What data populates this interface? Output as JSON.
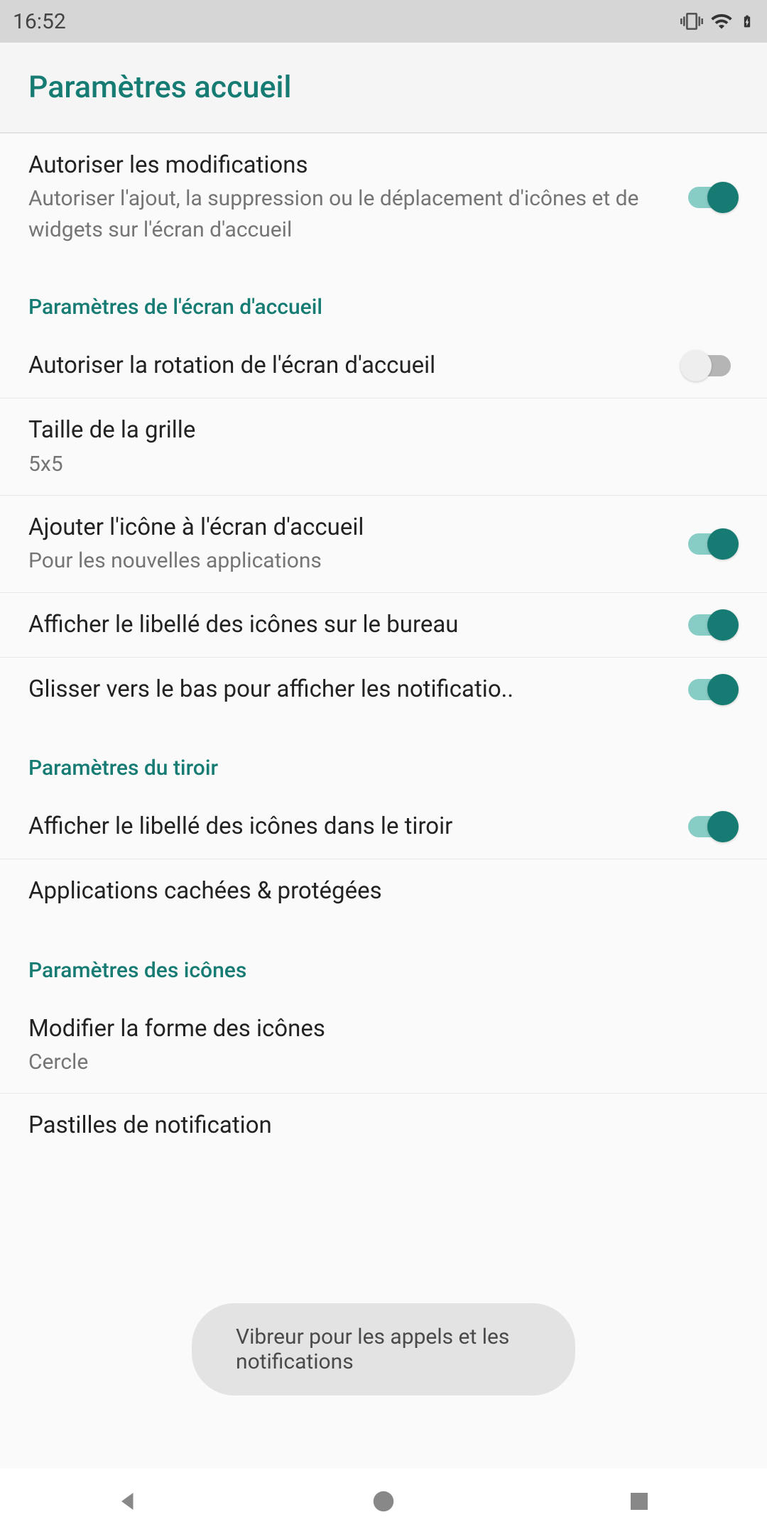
{
  "statusBar": {
    "time": "16:52"
  },
  "header": {
    "title": "Paramètres accueil"
  },
  "settings": {
    "allowEdit": {
      "title": "Autoriser les modifications",
      "subtitle": "Autoriser l'ajout, la suppression ou le déplacement d'icônes et de widgets sur l'écran d'accueil"
    }
  },
  "sectionHome": {
    "header": "Paramètres de l'écran d'accueil",
    "rotation": {
      "title": "Autoriser la rotation de l'écran d'accueil"
    },
    "gridSize": {
      "title": "Taille de la grille",
      "subtitle": "5x5"
    },
    "addIcon": {
      "title": "Ajouter l'icône à l'écran d'accueil",
      "subtitle": "Pour les nouvelles applications"
    },
    "showLabels": {
      "title": "Afficher le libellé des icônes sur le bureau"
    },
    "swipeDown": {
      "title": "Glisser vers le bas pour afficher les notificatio.."
    }
  },
  "sectionDrawer": {
    "header": "Paramètres du tiroir",
    "showLabels": {
      "title": "Afficher le libellé des icônes dans le tiroir"
    },
    "hiddenApps": {
      "title": "Applications cachées & protégées"
    }
  },
  "sectionIcons": {
    "header": "Paramètres des icônes",
    "iconShape": {
      "title": "Modifier la forme des icônes",
      "subtitle": "Cercle"
    },
    "notificationDots": {
      "title": "Pastilles de notification"
    }
  },
  "toast": "Vibreur pour les appels et les notifications"
}
